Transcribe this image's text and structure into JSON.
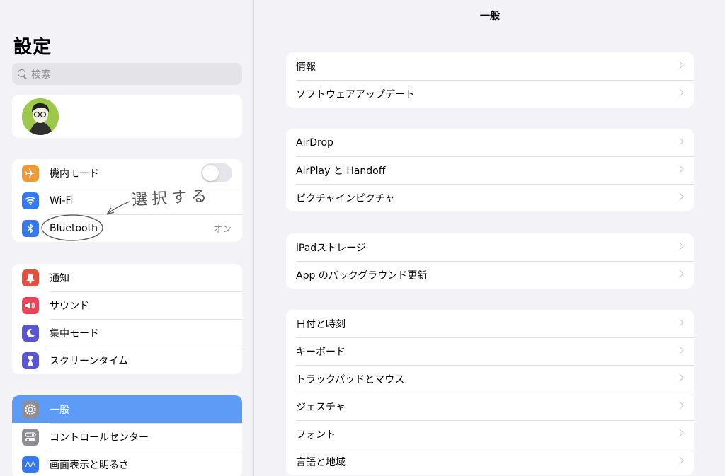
{
  "sidebar": {
    "title": "設定",
    "search_placeholder": "検索",
    "group1": [
      {
        "label": "機内モード",
        "icon": "airplane-icon",
        "color": "#f09a37"
      },
      {
        "label": "Wi-Fi",
        "icon": "wifi-icon",
        "color": "#3478f6"
      },
      {
        "label": "Bluetooth",
        "icon": "bluetooth-icon",
        "color": "#3478f6",
        "value": "オン"
      }
    ],
    "group2": [
      {
        "label": "通知",
        "icon": "bell-icon",
        "color": "#eb4e3d"
      },
      {
        "label": "サウンド",
        "icon": "speaker-icon",
        "color": "#eb445a"
      },
      {
        "label": "集中モード",
        "icon": "moon-icon",
        "color": "#5856d6"
      },
      {
        "label": "スクリーンタイム",
        "icon": "hourglass-icon",
        "color": "#5856d6"
      }
    ],
    "group3": [
      {
        "label": "一般",
        "icon": "gear-icon",
        "color": "#8e8e93"
      },
      {
        "label": "コントロールセンター",
        "icon": "switches-icon",
        "color": "#8e8e93"
      },
      {
        "label": "画面表示と明るさ",
        "icon": "text-size-icon",
        "color": "#3478f6"
      }
    ],
    "airplane_toggle": "off",
    "annotation": "選択する"
  },
  "main": {
    "title": "一般",
    "groups": [
      [
        "情報",
        "ソフトウェアアップデート"
      ],
      [
        "AirDrop",
        "AirPlay と Handoff",
        "ピクチャインピクチャ"
      ],
      [
        "iPadストレージ",
        "App のバックグラウンド更新"
      ],
      [
        "日付と時刻",
        "キーボード",
        "トラックパッドとマウス",
        "ジェスチャ",
        "フォント",
        "言語と地域"
      ]
    ]
  },
  "colors": {
    "accent": "#5d9bf6",
    "background": "#f2f2f7"
  }
}
